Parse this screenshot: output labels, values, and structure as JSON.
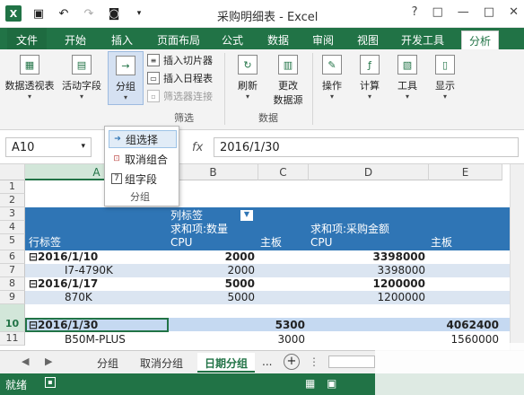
{
  "window": {
    "title": "采购明细表 - Excel"
  },
  "qat": {
    "excel_logo": "X",
    "help": "?",
    "restore": "□",
    "minimize": "—",
    "close": "✕"
  },
  "ribbon_tabs": [
    "文件",
    "开始",
    "插入",
    "页面布局",
    "公式",
    "数据",
    "审阅",
    "视图",
    "开发工具",
    "分析"
  ],
  "ribbon": {
    "pivot_table": "数据透视表",
    "active_field": "活动字段",
    "group": "分组",
    "insert_slicer": "插入切片器",
    "insert_timeline": "插入日程表",
    "filter_connections": "筛选器连接",
    "filter_group": "筛选",
    "refresh": "刷新",
    "change_source_1": "更改",
    "change_source_2": "数据源",
    "data_group": "数据",
    "actions": "操作",
    "calculations": "计算",
    "tools": "工具",
    "show": "显示"
  },
  "dropdown": {
    "items": [
      "组选择",
      "取消组合",
      "组字段"
    ],
    "label": "分组"
  },
  "formula_bar": {
    "name_box": "A10",
    "fx": "fx",
    "content": "2016/1/30"
  },
  "columns": [
    "A",
    "B",
    "C",
    "D",
    "E"
  ],
  "rows": [
    "1",
    "2",
    "3",
    "4",
    "5",
    "6",
    "7",
    "8",
    "9",
    "10",
    "11"
  ],
  "pivot": {
    "col_label": "列标签",
    "sum_qty": "求和项:数量",
    "sum_amount": "求和项:采购金额",
    "row_label": "行标签",
    "cpu": "CPU",
    "mainboard": "主板",
    "r6_label": "⊟2016/1/10",
    "r6_b": "2000",
    "r6_d": "3398000",
    "r7_label": "I7-4790K",
    "r7_b": "2000",
    "r7_d": "3398000",
    "r8_label": "⊟2016/1/17",
    "r8_b": "5000",
    "r8_d": "1200000",
    "r9_label": "870K",
    "r9_b": "5000",
    "r9_d": "1200000",
    "r10_label": "⊟2016/1/30",
    "r10_c": "5300",
    "r10_e": "4062400",
    "r11_label": "B50M-PLUS",
    "r11_c": "3000",
    "r11_e": "1560000"
  },
  "sheet_tabs": [
    "分组",
    "取消分组",
    "日期分组"
  ],
  "sheet_more": "...",
  "status": {
    "ready": "就绪"
  },
  "colors": {
    "excel_green": "#217346",
    "pivot_blue": "#2f75b5",
    "stripe": "#dbe5f1"
  }
}
